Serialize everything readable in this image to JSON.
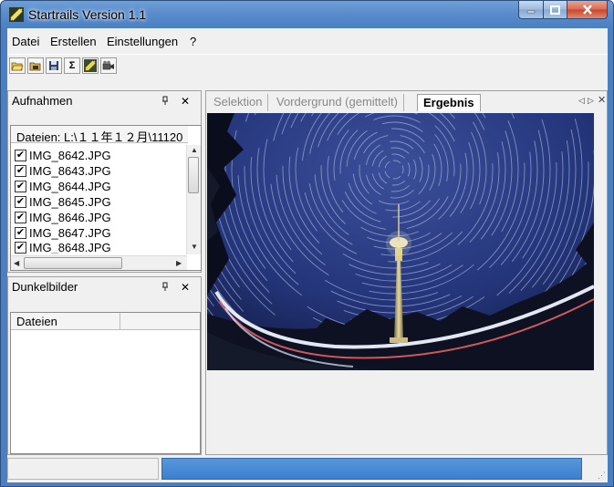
{
  "window": {
    "title": "Startrails Version 1.1",
    "icon": "startrails-app-icon",
    "buttons": {
      "minimize": "minimize-icon",
      "maximize": "maximize-icon",
      "close": "close-icon"
    }
  },
  "menu": {
    "items": [
      "Datei",
      "Erstellen",
      "Einstellungen",
      "?"
    ]
  },
  "toolbar": {
    "buttons": [
      {
        "icon": "open-folder-icon",
        "glyph": ""
      },
      {
        "icon": "open-darkframes-icon",
        "glyph": ""
      },
      {
        "icon": "save-icon",
        "glyph": ""
      },
      {
        "icon": "sum-icon",
        "glyph": "Σ"
      },
      {
        "icon": "startrails-build-icon",
        "glyph": ""
      },
      {
        "icon": "video-icon",
        "glyph": ""
      }
    ]
  },
  "panels": {
    "aufnahmen": {
      "title": "Aufnahmen",
      "column_header": "Dateien: L:\\１１年１２月\\11120",
      "files": [
        {
          "name": "IMG_8642.JPG",
          "checked": true
        },
        {
          "name": "IMG_8643.JPG",
          "checked": true
        },
        {
          "name": "IMG_8644.JPG",
          "checked": true
        },
        {
          "name": "IMG_8645.JPG",
          "checked": true
        },
        {
          "name": "IMG_8646.JPG",
          "checked": true
        },
        {
          "name": "IMG_8647.JPG",
          "checked": true
        },
        {
          "name": "IMG_8648.JPG",
          "checked": true
        }
      ]
    },
    "dunkelbilder": {
      "title": "Dunkelbilder",
      "column_header": "Dateien"
    }
  },
  "document": {
    "tabs": [
      {
        "label": "Selektion",
        "active": false
      },
      {
        "label": "Vordergrund (gemittelt)",
        "active": false
      },
      {
        "label": "Ergebnis",
        "active": true
      }
    ]
  },
  "status": {
    "progress_fraction": 0.97
  },
  "colors": {
    "progress": "#3c7fd0",
    "sky": "#1e2b5e"
  }
}
